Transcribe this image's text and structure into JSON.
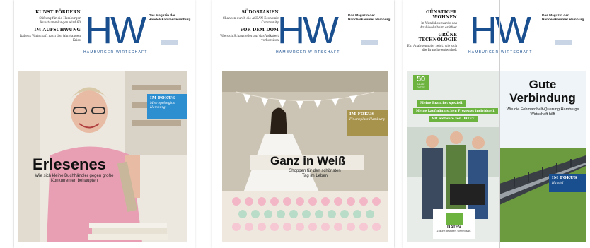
{
  "covers": [
    {
      "kickers": [
        {
          "head": "KUNST FÖRDERN",
          "text": "Stiftung für die Hamburger Kunstsammlungen wird 60"
        },
        {
          "head": "IM AUFSCHWUNG",
          "text": "Italiens Wirtschaft nach der jahrelangen Krise"
        }
      ],
      "logo": "HW",
      "logo_sub": "HAMBURGER WIRTSCHAFT",
      "magazine": "Das Magazin der Handelskammer Hamburg",
      "fokus": {
        "head": "IM FOKUS",
        "sub": "Metropolregion Hamburg",
        "color": "#2d8fd0"
      },
      "headline": "Erlesenes",
      "subline": "Wie sich kleine Buchhändler gegen große Konkurrenten behaupten"
    },
    {
      "kickers": [
        {
          "head": "SÜDOSTASIEN",
          "text": "Chancen durch die ASEAN Economic Community"
        },
        {
          "head": "VOR DEM DOM",
          "text": "Wie sich Schausteller auf das Volksfest vorbereiten"
        }
      ],
      "logo": "HW",
      "logo_sub": "HAMBURGER WIRTSCHAFT",
      "magazine": "Das Magazin der Handelskammer Hamburg",
      "fokus": {
        "head": "IM FOKUS",
        "sub": "Finanzplatz Hamburg",
        "color": "#a8934c"
      },
      "headline": "Ganz in Weiß",
      "subline": "Shoppen für den schönsten Tag im Leben"
    },
    {
      "kickers": [
        {
          "head": "GÜNSTIGER WOHNEN",
          "text": "In Wandsbek wurde das Azubiwohnheim eröffnet"
        },
        {
          "head": "GRÜNE TECHNOLOGIE",
          "text": "Ein Analysepapier zeigt, wie sich die Branche entwickelt"
        }
      ],
      "logo": "HW",
      "logo_sub": "HAMBURGER WIRTSCHAFT",
      "magazine": "Das Magazin der Handelskammer Hamburg",
      "ad": {
        "badge_num": "50",
        "badge_text": "JAHRE DATEV",
        "line1": "Meine Branche: speziell.",
        "line2": "Meine kaufmännischen Prozesse: individuell.",
        "line3": "Mit Software von DATEV.",
        "brand": "DATEV",
        "tagline": "Zukunft gestalten. Gemeinsam."
      },
      "fokus": {
        "head": "IM FOKUS",
        "sub": "Handel",
        "color": "#1a4f8f"
      },
      "headline": "Gute Verbindung",
      "subline": "Wie die Fehmarnbelt-Querung Hamburgs Wirtschaft hilft"
    }
  ]
}
